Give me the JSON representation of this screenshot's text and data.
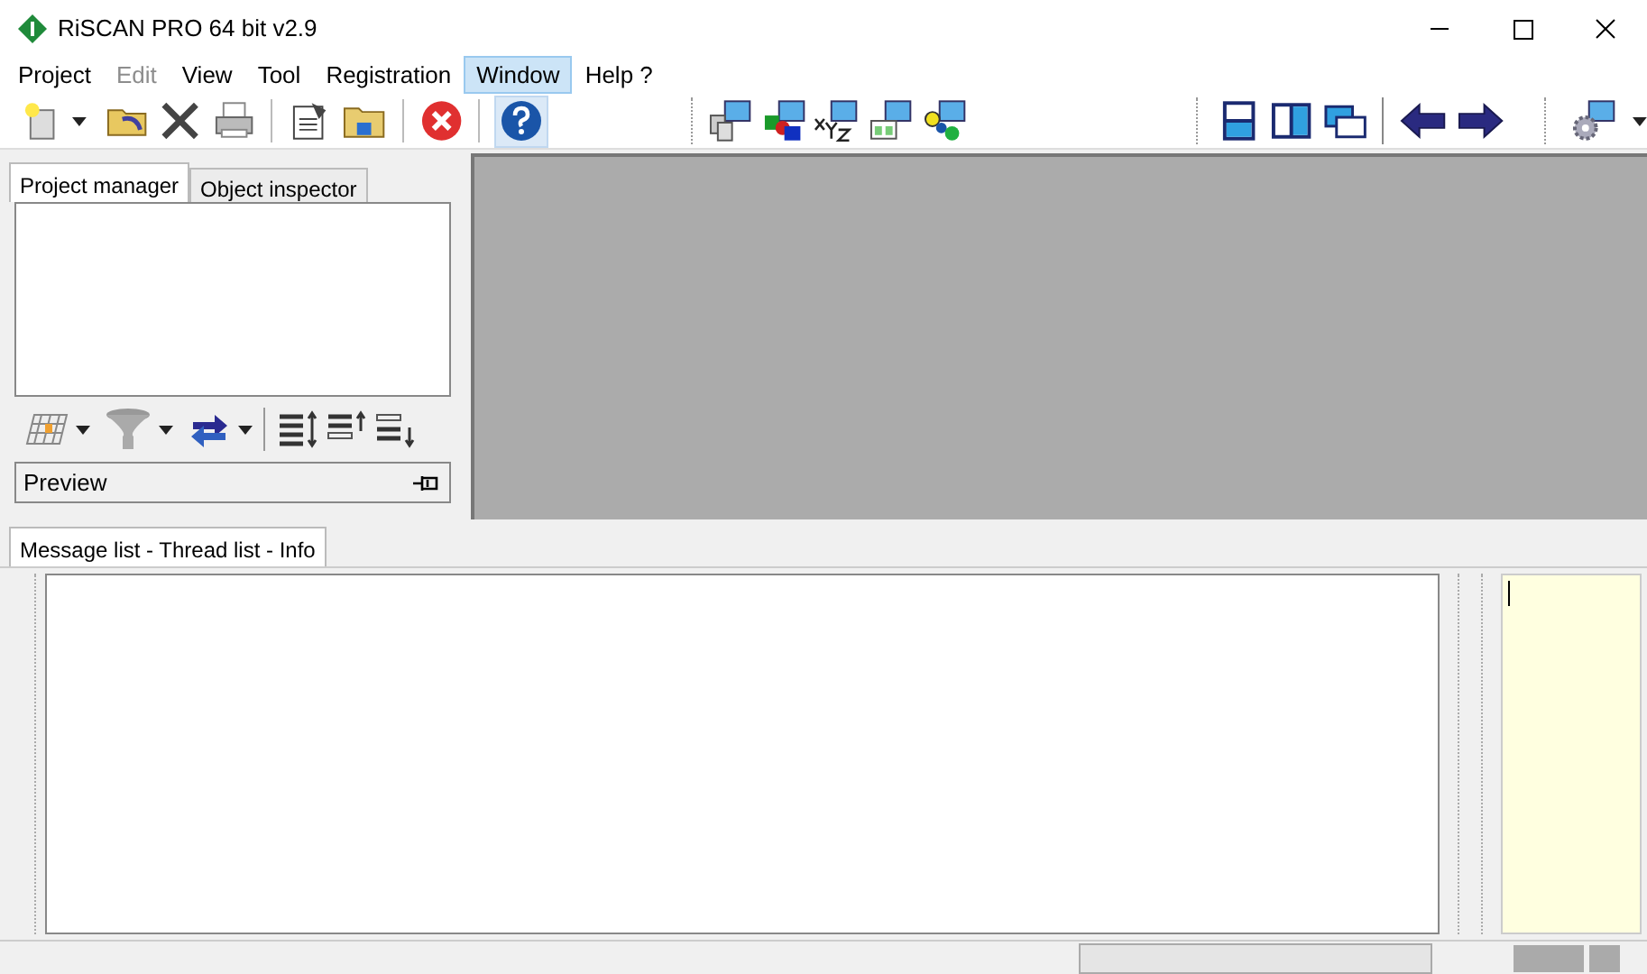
{
  "window": {
    "title": "RiSCAN PRO 64 bit v2.9"
  },
  "menu": [
    {
      "label": "Project",
      "disabled": false,
      "selected": false
    },
    {
      "label": "Edit",
      "disabled": true,
      "selected": false
    },
    {
      "label": "View",
      "disabled": false,
      "selected": false
    },
    {
      "label": "Tool",
      "disabled": false,
      "selected": false
    },
    {
      "label": "Registration",
      "disabled": false,
      "selected": false
    },
    {
      "label": "Window",
      "disabled": false,
      "selected": true
    },
    {
      "label": "Help ?",
      "disabled": false,
      "selected": false
    }
  ],
  "left_tabs": [
    {
      "label": "Project manager",
      "selected": true
    },
    {
      "label": "Object inspector",
      "selected": false
    }
  ],
  "preview": {
    "label": "Preview"
  },
  "bottom_tabs": [
    {
      "label": "Message list - Thread list - Info",
      "selected": true
    }
  ]
}
